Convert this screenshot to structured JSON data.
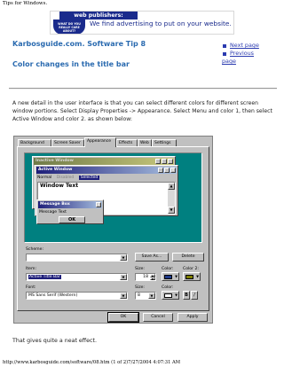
{
  "document": {
    "title": "Tips for Windows.",
    "footer": "http://www.karbosguide.com/software/08.htm (1 of 2)7/27/2004 4:07:31 AM"
  },
  "ad": {
    "headline": "web publishers:",
    "tagline": "We find advertising to put on your website.",
    "badge": "WHAT DO YOU REALLY CARE ABOUT?"
  },
  "page": {
    "tip_heading": "Karbosguide.com. Software Tip 8",
    "sub_heading": "Color changes in the title bar",
    "nav": {
      "next": "Next page",
      "previous": "Previous",
      "previous_cont": "page"
    },
    "body": "A new detail in the user interface is that you can select different colors for different screen window portions. Select Display Properties -> Appearance. Select Menu and color 1, then select Active Window and color 2. as shown below:",
    "closing": "That gives quite a neat effect."
  },
  "dialog": {
    "tabs": [
      "Background",
      "Screen Saver",
      "Appearance",
      "Effects",
      "Web",
      "Settings"
    ],
    "active_tab": "Appearance",
    "preview": {
      "inactive_title": "Inactive Window",
      "active_title": "Active Window",
      "menu_normal": "Normal",
      "menu_disabled": "Disabled",
      "menu_selected": "Selected",
      "window_text": "Window Text",
      "msgbox_title": "Message Box",
      "msgbox_text": "Message Text",
      "ok": "OK"
    },
    "scheme_label": "Scheme:",
    "scheme_value": "",
    "save_as": "Save As...",
    "delete": "Delete",
    "item_label": "Item:",
    "item_value": "Active Title Bar",
    "size_label": "Size:",
    "size_value": "18",
    "color_label": "Color:",
    "color2_label": "Color 2:",
    "font_label": "Font:",
    "font_value": "MS Sans Serif (Western)",
    "font_size_label": "Size:",
    "font_size_value": "8",
    "font_color_label": "Color:",
    "bold": "B",
    "italic": "/",
    "ok_button": "OK",
    "cancel_button": "Cancel",
    "apply_button": "Apply",
    "colors": {
      "color1": "#1e3a8a",
      "color2": "#808000",
      "font_color": "#ffffff"
    }
  }
}
